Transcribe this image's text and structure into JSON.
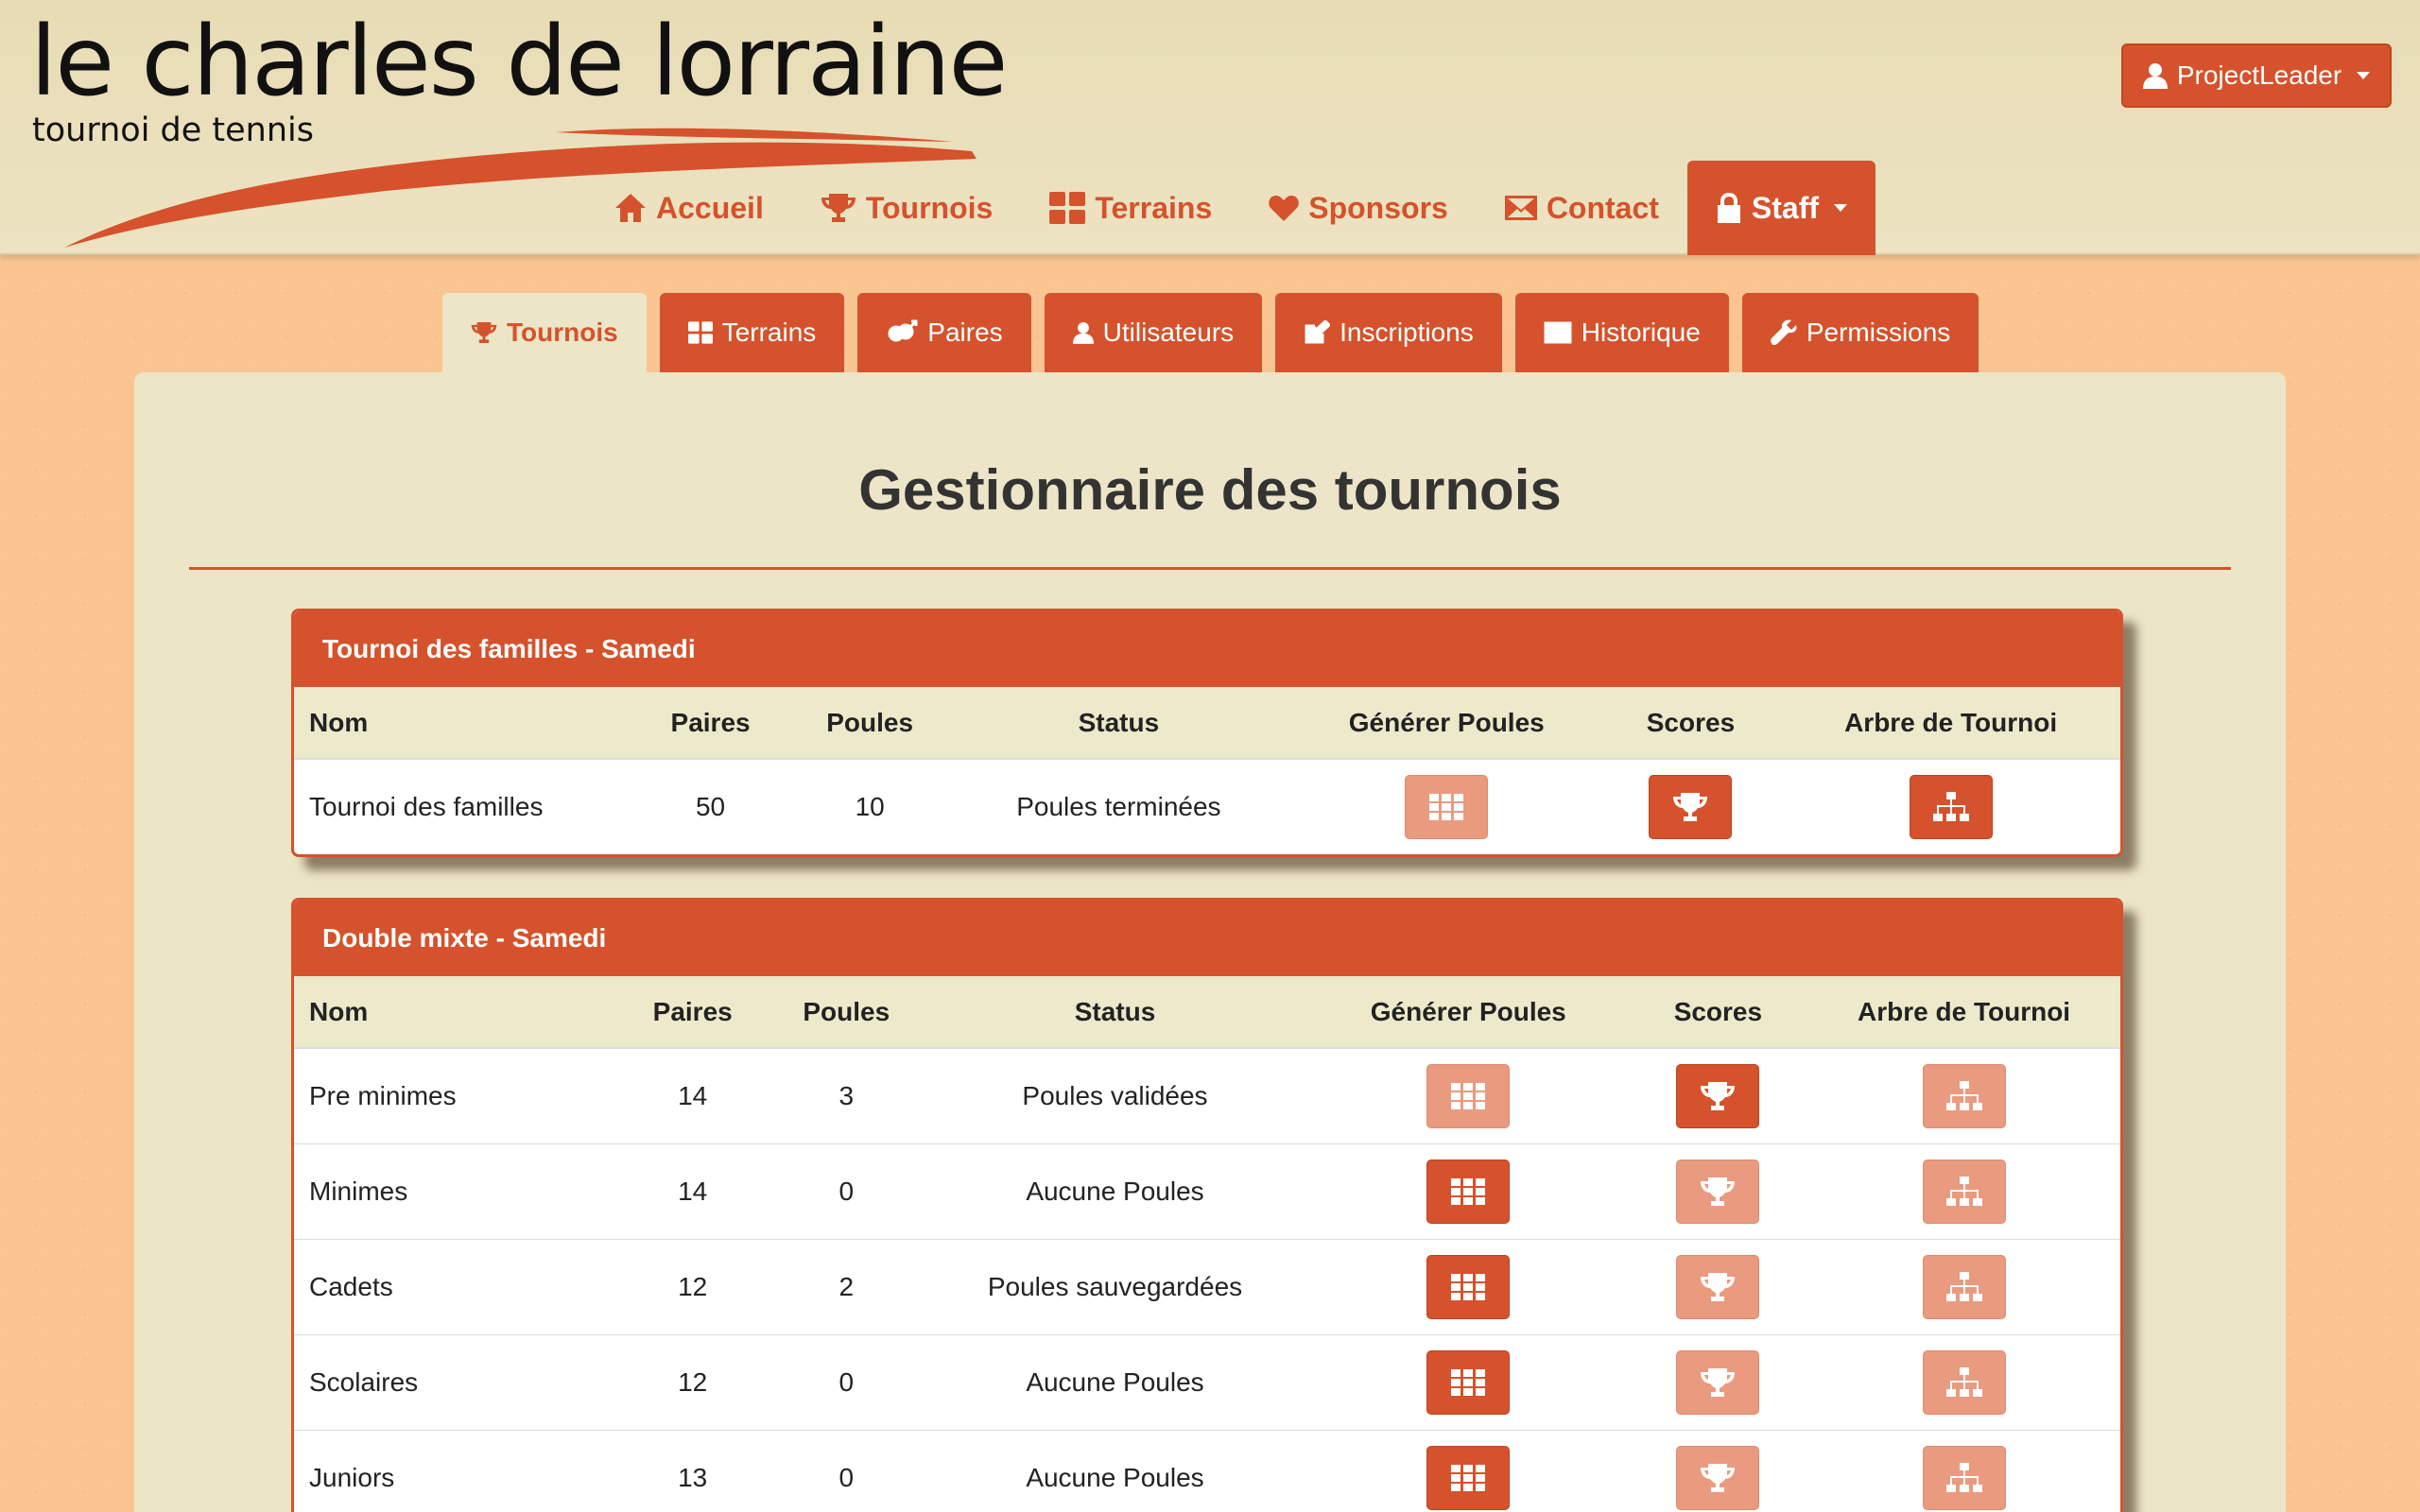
{
  "logo": {
    "title": "le charles de lorraine",
    "subtitle": "tournoi de tennis"
  },
  "user": {
    "label": "ProjectLeader"
  },
  "main_nav": [
    {
      "label": "Accueil",
      "icon": "home-icon"
    },
    {
      "label": "Tournois",
      "icon": "trophy-icon"
    },
    {
      "label": "Terrains",
      "icon": "grid-icon"
    },
    {
      "label": "Sponsors",
      "icon": "heart-icon"
    },
    {
      "label": "Contact",
      "icon": "envelope-icon"
    },
    {
      "label": "Staff",
      "icon": "lock-icon"
    }
  ],
  "sub_tabs": [
    {
      "label": "Tournois",
      "icon": "trophy-icon",
      "active": true
    },
    {
      "label": "Terrains",
      "icon": "grid-icon"
    },
    {
      "label": "Paires",
      "icon": "gender-icon"
    },
    {
      "label": "Utilisateurs",
      "icon": "user-icon"
    },
    {
      "label": "Inscriptions",
      "icon": "edit-icon"
    },
    {
      "label": "Historique",
      "icon": "list-icon"
    },
    {
      "label": "Permissions",
      "icon": "wrench-icon"
    }
  ],
  "page": {
    "title": "Gestionnaire des tournois"
  },
  "columns": {
    "nom": "Nom",
    "paires": "Paires",
    "poules": "Poules",
    "status": "Status",
    "generer": "Générer Poules",
    "scores": "Scores",
    "arbre": "Arbre de Tournoi"
  },
  "tournaments": [
    {
      "title": "Tournoi des familles - Samedi",
      "rows": [
        {
          "nom": "Tournoi des familles",
          "paires": "50",
          "poules": "10",
          "status": "Poules terminées",
          "generer_active": false,
          "scores_active": true,
          "arbre_active": true
        }
      ]
    },
    {
      "title": "Double mixte - Samedi",
      "rows": [
        {
          "nom": "Pre minimes",
          "paires": "14",
          "poules": "3",
          "status": "Poules validées",
          "generer_active": false,
          "scores_active": true,
          "arbre_active": false
        },
        {
          "nom": "Minimes",
          "paires": "14",
          "poules": "0",
          "status": "Aucune Poules",
          "generer_active": true,
          "scores_active": false,
          "arbre_active": false
        },
        {
          "nom": "Cadets",
          "paires": "12",
          "poules": "2",
          "status": "Poules sauvegardées",
          "generer_active": true,
          "scores_active": false,
          "arbre_active": false
        },
        {
          "nom": "Scolaires",
          "paires": "12",
          "poules": "0",
          "status": "Aucune Poules",
          "generer_active": true,
          "scores_active": false,
          "arbre_active": false
        },
        {
          "nom": "Juniors",
          "paires": "13",
          "poules": "0",
          "status": "Aucune Poules",
          "generer_active": true,
          "scores_active": false,
          "arbre_active": false
        }
      ]
    }
  ],
  "colors": {
    "accent": "#d5522c",
    "accent_faded": "#e99a7f",
    "panel": "#ede5c8",
    "background": "#fbc592"
  }
}
